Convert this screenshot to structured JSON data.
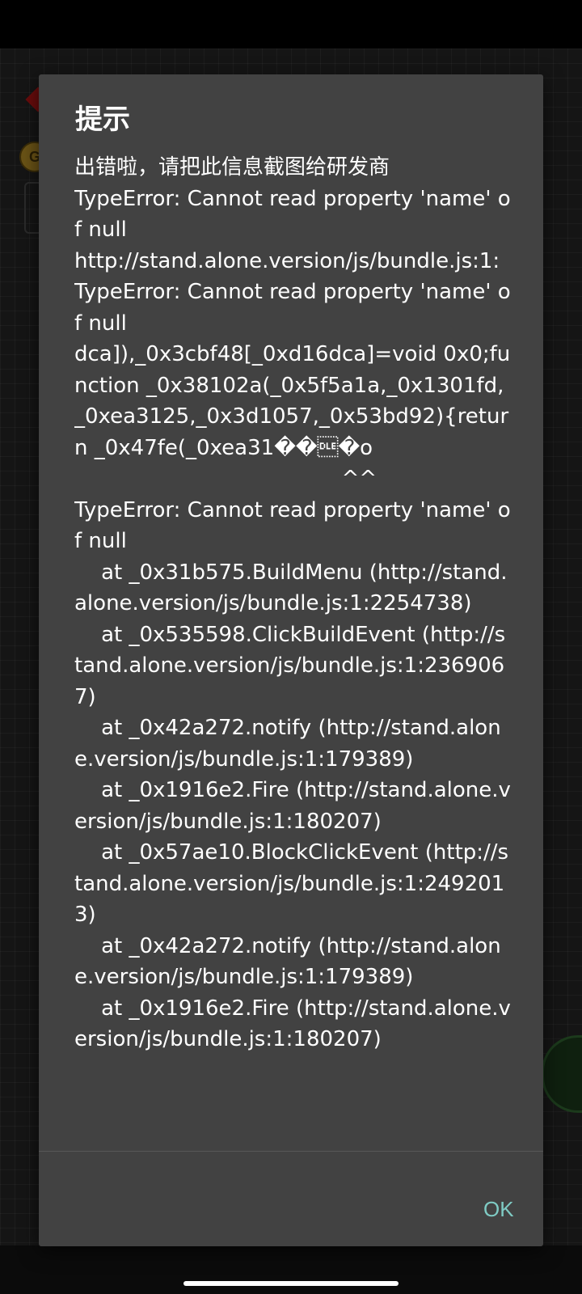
{
  "background": {
    "coin_label": "G"
  },
  "dialog": {
    "title": "提示",
    "message": "出错啦，请把此信息截图给研发商\nTypeError: Cannot read property 'name' of null\nhttp://stand.alone.version/js/bundle.js:1:\nTypeError: Cannot read property 'name' of null\ndca]),_0x3cbf48[_0xd16dca]=void 0x0;function _0x38102a(_0x5f5a1a,_0x1301fd,_0xea3125,_0x3d1057,_0x53bd92){return _0x47fe(_0xea31��\u0010�o\n                                        ^^\nTypeError: Cannot read property 'name' of null\n    at _0x31b575.BuildMenu (http://stand.alone.version/js/bundle.js:1:2254738)\n    at _0x535598.ClickBuildEvent (http://stand.alone.version/js/bundle.js:1:2369067)\n    at _0x42a272.notify (http://stand.alone.version/js/bundle.js:1:179389)\n    at _0x1916e2.Fire (http://stand.alone.version/js/bundle.js:1:180207)\n    at _0x57ae10.BlockClickEvent (http://stand.alone.version/js/bundle.js:1:2492013)\n    at _0x42a272.notify (http://stand.alone.version/js/bundle.js:1:179389)\n    at _0x1916e2.Fire (http://stand.alone.version/js/bundle.js:1:180207)",
    "ok_label": "OK"
  },
  "colors": {
    "dialog_background": "#424242",
    "accent": "#7fcbc4",
    "text": "#ffffff"
  }
}
